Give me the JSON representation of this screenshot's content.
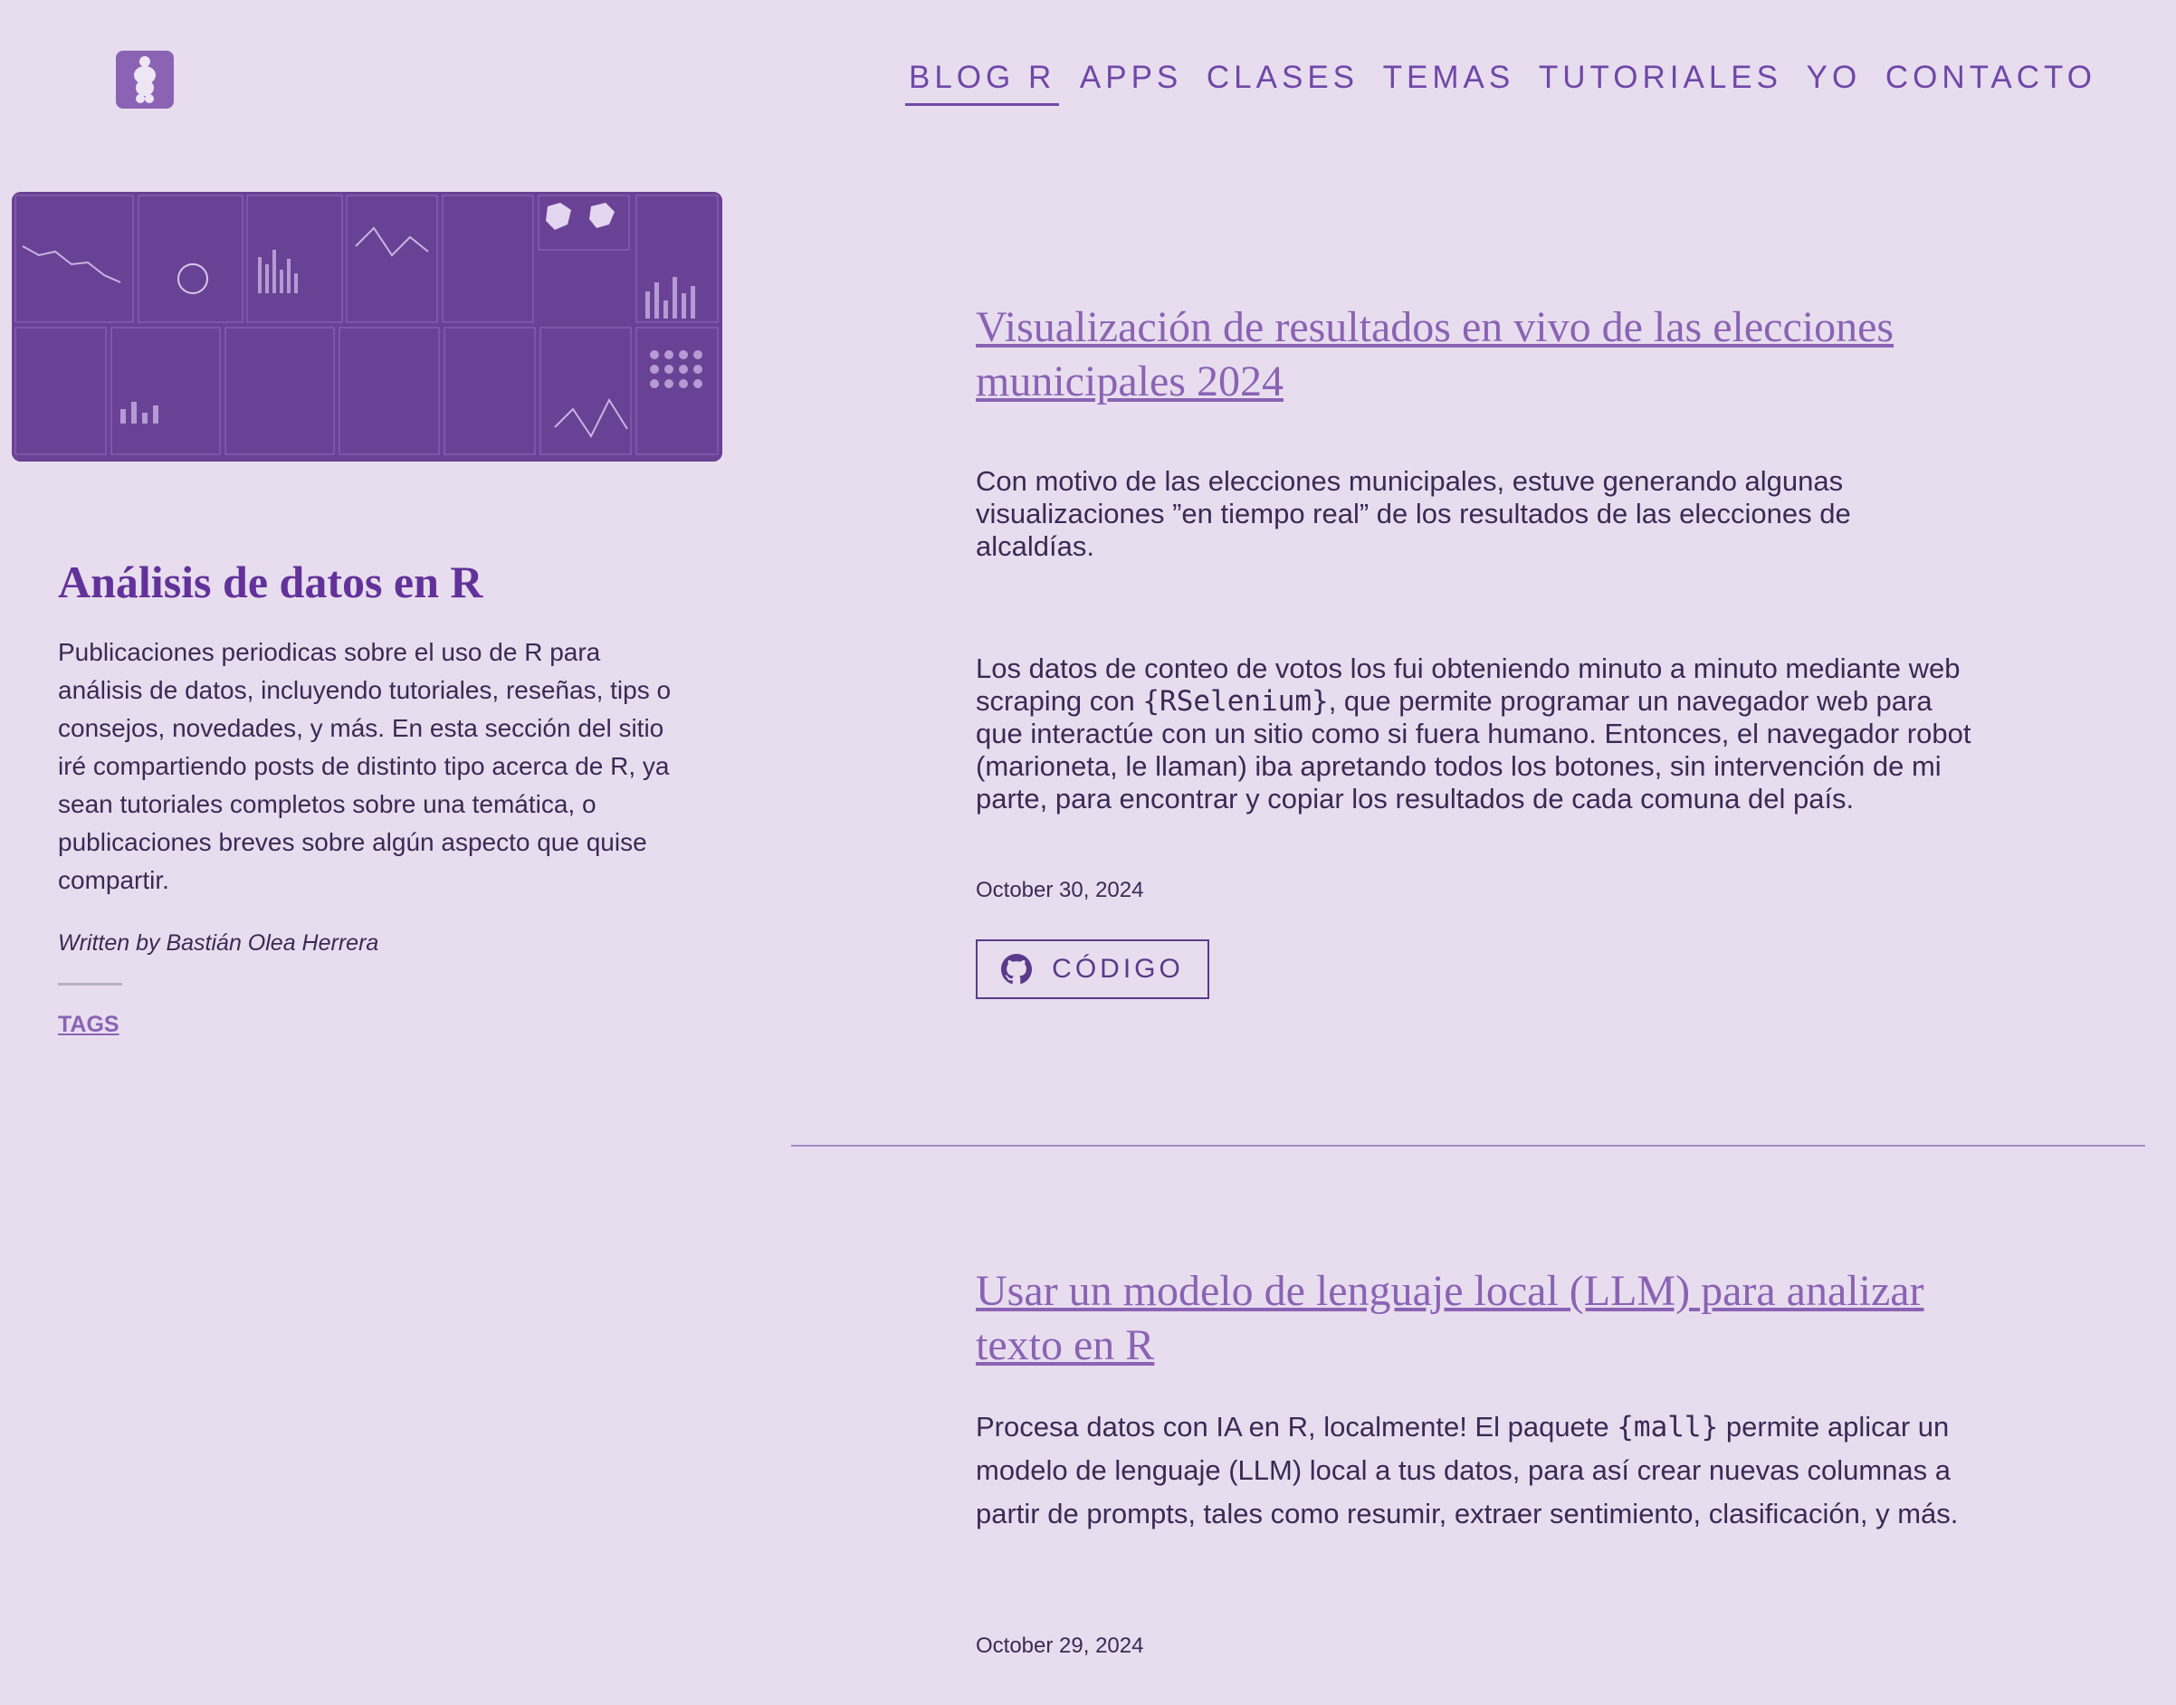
{
  "header": {
    "logo_icon": "venus-figurine-icon",
    "nav": [
      "BLOG R",
      "APPS",
      "CLASES",
      "TEMAS",
      "TUTORIALES",
      "YO",
      "CONTACTO"
    ],
    "active_nav": "BLOG R"
  },
  "sidebar": {
    "title": "Análisis de datos en R",
    "description": "Publicaciones periodicas sobre el uso de R para análisis de datos, incluyendo tutoriales, reseñas, tips o consejos, novedades, y más. En esta sección del sitio iré compartiendo posts de distinto tipo acerca de R, ya sean tutoriales completos sobre una temática, o publicaciones breves sobre algún aspecto que quise compartir.",
    "author": "Written by Bastián Olea Herrera",
    "tags_label": "TAGS"
  },
  "posts": [
    {
      "title": "Visualización de resultados en vivo de las elecciones municipales 2024",
      "p1": "Con motivo de las elecciones municipales, estuve generando algunas visualizaciones ”en tiempo real” de los resultados de las elecciones de alcaldías.",
      "p2_before": "Los datos de conteo de votos los fui obteniendo minuto a minuto mediante web scraping con ",
      "p2_code": "{RSelenium}",
      "p2_after": ", que permite programar un navegador web para que interactúe con un sitio como si fuera humano. Entonces, el navegador robot (marioneta, le llaman) iba apretando todos los botones, sin intervención de mi parte, para encontrar y copiar los resultados de cada comuna del país.",
      "date": "October 30, 2024",
      "button_label": "CÓDIGO",
      "button_icon": "github-icon"
    },
    {
      "title": "Usar un modelo de lenguaje local (LLM) para analizar texto en R",
      "p1_before": "Procesa datos con IA en R, localmente! El paquete ",
      "p1_code": "{mall}",
      "p1_after": " permite aplicar un modelo de lenguaje (LLM) local a tus datos, para así crear nuevas columnas a partir de prompts, tales como resumir, extraer sentimiento, clasificación, y más.",
      "date": "October 29, 2024"
    }
  ]
}
